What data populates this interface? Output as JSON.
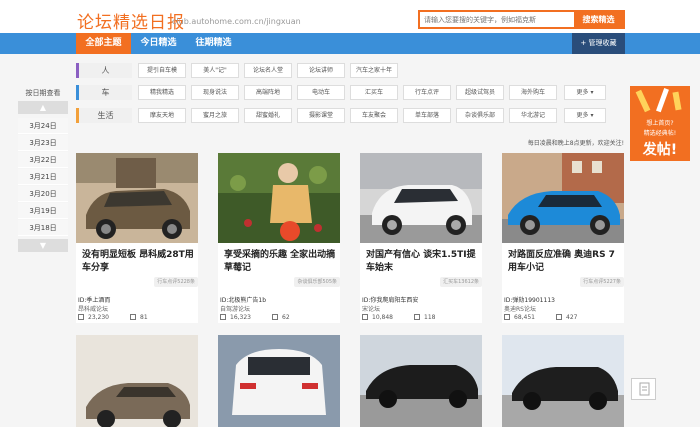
{
  "header": {
    "logo": "论坛精选日报",
    "logo_url": "club.autohome.com.cn/jingxuan",
    "search_placeholder": "请输入您要搜的关键字，例如福克斯",
    "search_button": "搜索精选"
  },
  "nav": {
    "items": [
      "全部主题",
      "今日精选",
      "往期精选"
    ],
    "manage": "+ 管理收藏"
  },
  "categories": [
    {
      "label": "人",
      "tags": [
        "提引自车模",
        "美人\"记\"",
        "论坛名人堂",
        "论坛讲师",
        "汽车之家十年"
      ]
    },
    {
      "label": "车",
      "tags": [
        "精我精选",
        "现身说法",
        "高端阵地",
        "电动车",
        "汇买车",
        "行车点评",
        "超级试驾员",
        "海外购车",
        "更多 ▾"
      ]
    },
    {
      "label": "生活",
      "tags": [
        "摩友天地",
        "蜜月之旅",
        "甜蜜婚礼",
        "摄影课堂",
        "车友聚会",
        "单车部落",
        "杂谈俱乐部",
        "华北游记",
        "更多 ▾"
      ]
    }
  ],
  "dates": {
    "title": "按日期查看",
    "items": [
      "3月24日",
      "3月23日",
      "3月22日",
      "3月21日",
      "3月20日",
      "3月19日",
      "3月18日"
    ]
  },
  "info": "每日凌晨和晚上8点更新，欢迎关注!",
  "cards": [
    {
      "title": "没有明显短板 昂科威28T用车分享",
      "badge": "行车点评5228条",
      "user": "ID:季上酒而",
      "forum": "昂科威论坛",
      "views": "23,230",
      "replies": "81"
    },
    {
      "title": "享受采摘的乐趣 全家出动摘草莓记",
      "badge": "杂谈俱乐部505条",
      "user": "ID:北极熊广告1b",
      "forum": "自驾游论坛",
      "views": "16,323",
      "replies": "62"
    },
    {
      "title": "对国产有信心 谈宋1.5TI提车始末",
      "badge": "汇买车13612条",
      "user": "ID:你我爬肩阳车西安",
      "forum": "宋论坛",
      "views": "10,848",
      "replies": "118"
    },
    {
      "title": "对路面反应准确 奥迪RS 7用车小记",
      "badge": "行车点评5227条",
      "user": "ID:弹劾19901113",
      "forum": "奥迪RS论坛",
      "views": "68,451",
      "replies": "427"
    }
  ],
  "ad": {
    "line1": "想上首页?",
    "line2": "精选经典帖!",
    "line3": "发帖!"
  }
}
